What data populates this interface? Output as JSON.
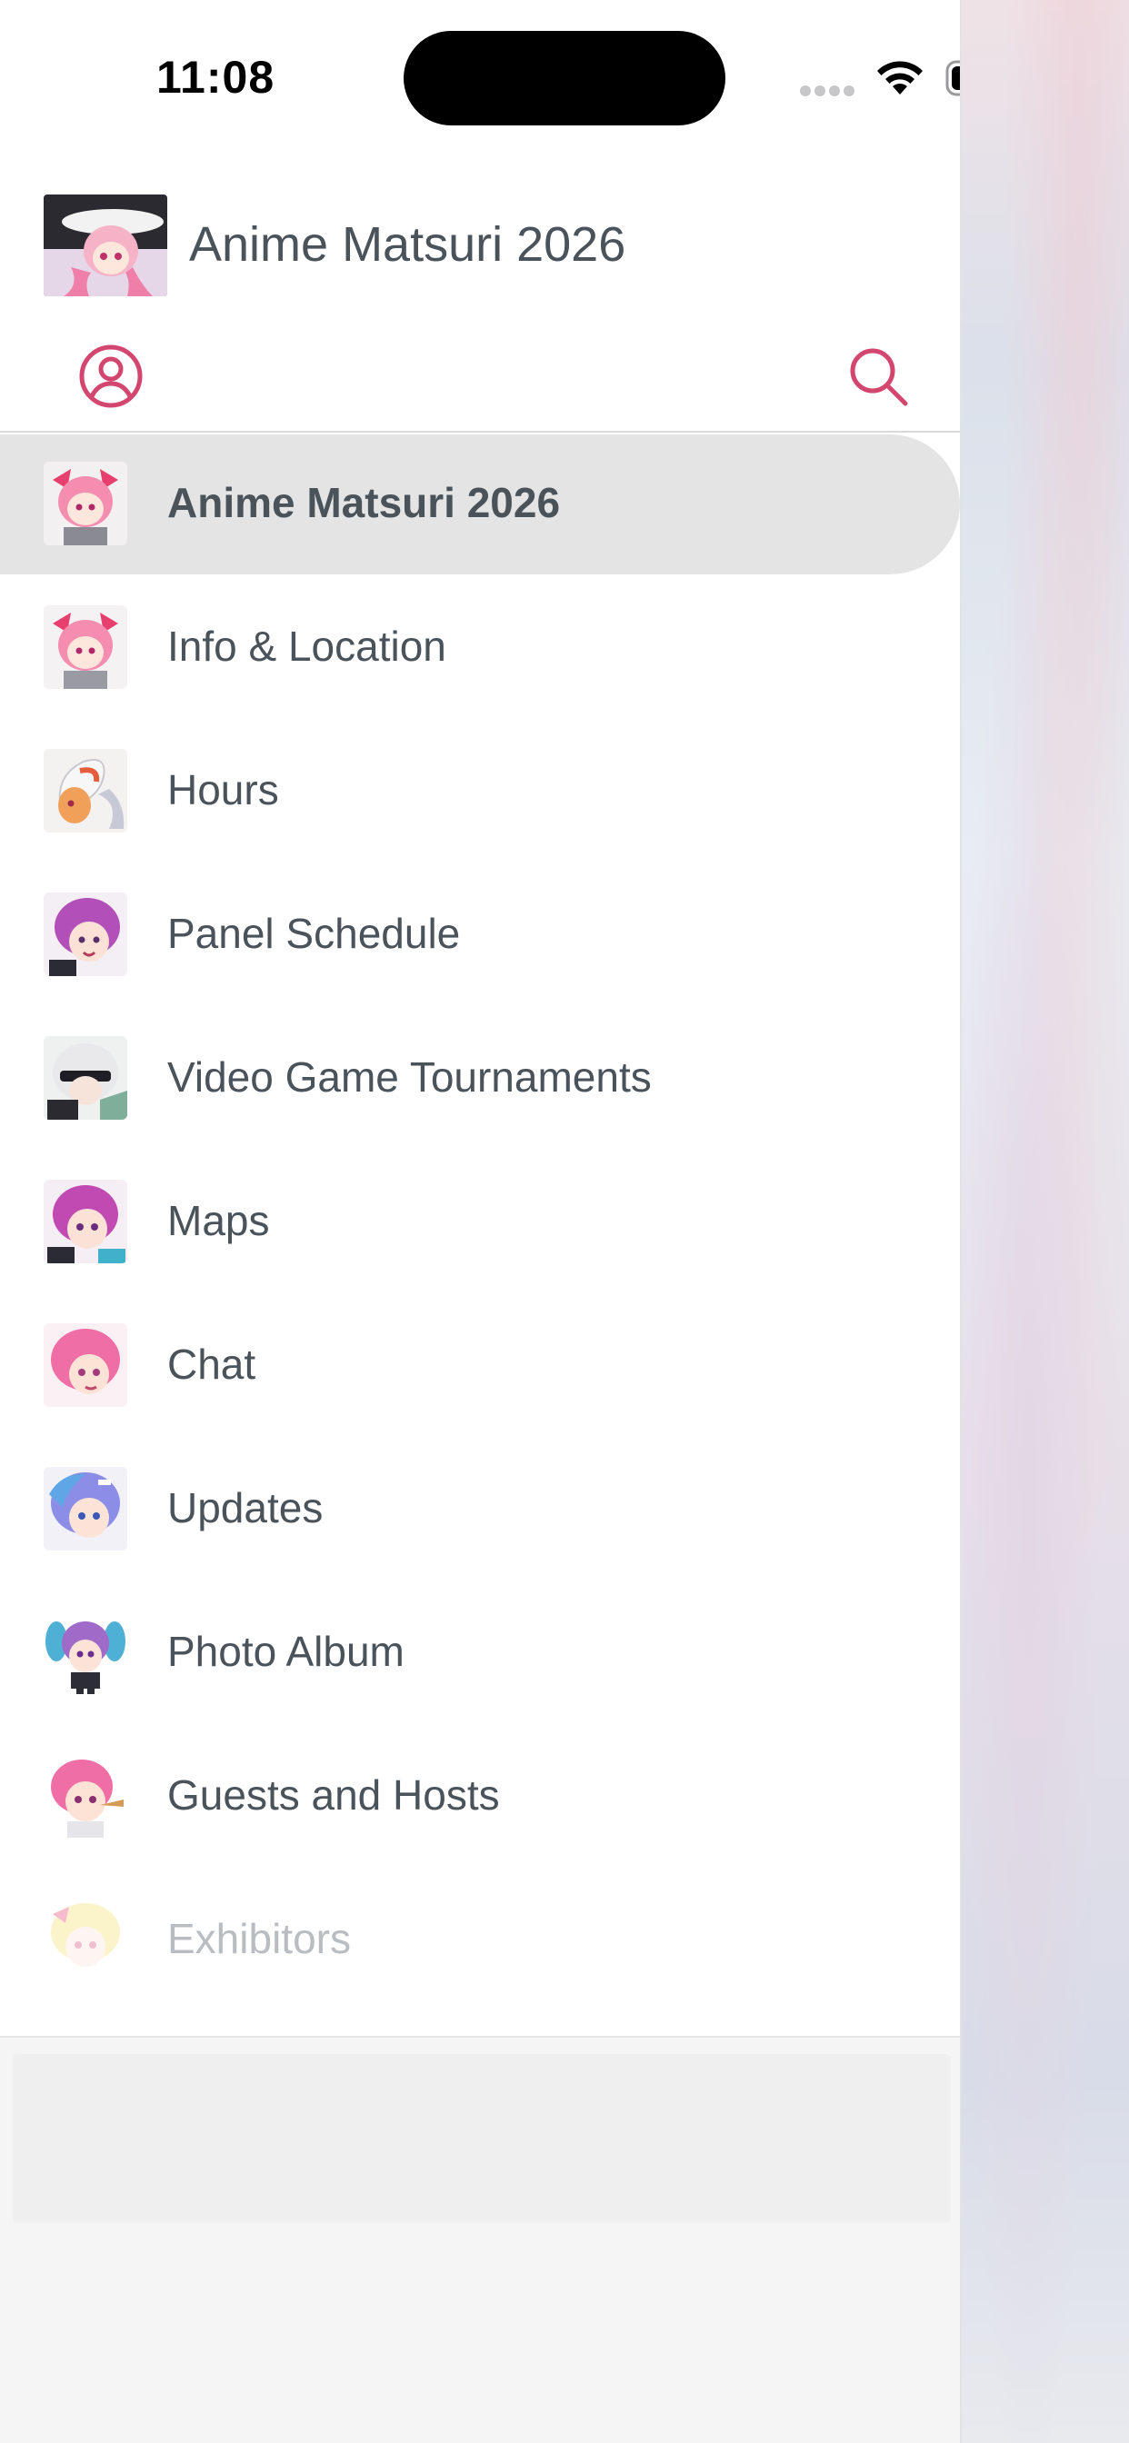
{
  "status_bar": {
    "time": "11:08"
  },
  "header": {
    "title": "Anime Matsuri 2026",
    "profile_icon": "user-circle-icon",
    "search_icon": "search-icon"
  },
  "colors": {
    "accent": "#d2466f",
    "text": "#4a525a",
    "selected_bg": "#e4e4e4",
    "faded_text": "#b9bdc2"
  },
  "menu": {
    "items": [
      {
        "label": "Anime Matsuri 2026",
        "selected": true
      },
      {
        "label": "Info & Location"
      },
      {
        "label": "Hours"
      },
      {
        "label": "Panel Schedule"
      },
      {
        "label": "Video Game Tournaments"
      },
      {
        "label": "Maps"
      },
      {
        "label": "Chat"
      },
      {
        "label": "Updates"
      },
      {
        "label": "Photo Album"
      },
      {
        "label": "Guests and Hosts"
      },
      {
        "label": "Exhibitors"
      }
    ]
  }
}
